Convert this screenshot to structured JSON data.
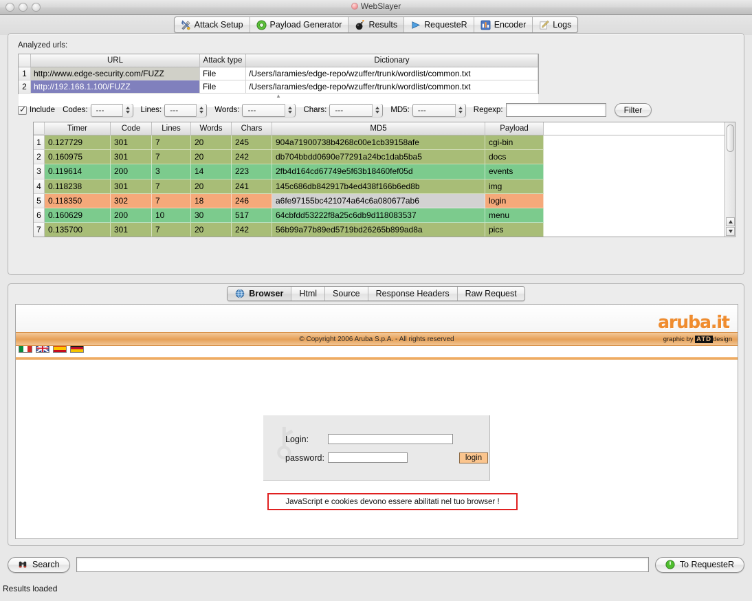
{
  "window": {
    "title": "WebSlayer"
  },
  "main_tabs": [
    {
      "label": "Attack Setup",
      "icon": "wrench-screwdriver-icon",
      "selected": false
    },
    {
      "label": "Payload Generator",
      "icon": "green-gear-icon",
      "selected": false
    },
    {
      "label": "Results",
      "icon": "bomb-icon",
      "selected": true
    },
    {
      "label": "RequesteR",
      "icon": "blue-play-icon",
      "selected": false
    },
    {
      "label": "Encoder",
      "icon": "blue-grid-icon",
      "selected": false
    },
    {
      "label": "Logs",
      "icon": "pencil-note-icon",
      "selected": false
    }
  ],
  "urls_section": {
    "label": "Analyzed urls:",
    "columns": [
      "",
      "URL",
      "Attack type",
      "Dictionary"
    ],
    "rows": [
      {
        "num": "1",
        "url": "http://www.edge-security.com/FUZZ",
        "attack_type": "File",
        "dictionary": "/Users/laramies/edge-repo/wzuffer/trunk/wordlist/common.txt",
        "state": "highlight"
      },
      {
        "num": "2",
        "url": "http://192.168.1.100/FUZZ",
        "attack_type": "File",
        "dictionary": "/Users/laramies/edge-repo/wzuffer/trunk/wordlist/common.txt",
        "state": "selected"
      }
    ]
  },
  "filter_bar": {
    "include_label": "Include",
    "include_checked": true,
    "codes_label": "Codes:",
    "codes_value": "---",
    "lines_label": "Lines:",
    "lines_value": "---",
    "words_label": "Words:",
    "words_value": "---",
    "chars_label": "Chars:",
    "chars_value": "---",
    "md5_label": "MD5:",
    "md5_value": "---",
    "regexp_label": "Regexp:",
    "regexp_value": "",
    "regexp_placeholder": "",
    "filter_button": "Filter"
  },
  "results_table": {
    "columns": [
      "",
      "Timer",
      "Code",
      "Lines",
      "Words",
      "Chars",
      "MD5",
      "Payload"
    ],
    "colors": {
      "green_200": "#7ccb8d",
      "olive_301": "#a8bd77",
      "orange_302": "#f5a97a",
      "md5_grey": "#d2d2d2"
    },
    "rows": [
      {
        "num": "1",
        "timer": "0.127729",
        "code": "301",
        "lines": "7",
        "words": "20",
        "chars": "245",
        "md5": "904a71900738b4268c00e1cb39158afe",
        "payload": "cgi-bin",
        "color": "olive"
      },
      {
        "num": "2",
        "timer": "0.160975",
        "code": "301",
        "lines": "7",
        "words": "20",
        "chars": "242",
        "md5": "db704bbdd0690e77291a24bc1dab5ba5",
        "payload": "docs",
        "color": "olive"
      },
      {
        "num": "3",
        "timer": "0.119614",
        "code": "200",
        "lines": "3",
        "words": "14",
        "chars": "223",
        "md5": "2fb4d164cd67749e5f63b18460fef05d",
        "payload": "events",
        "color": "green"
      },
      {
        "num": "4",
        "timer": "0.118238",
        "code": "301",
        "lines": "7",
        "words": "20",
        "chars": "241",
        "md5": "145c686db842917b4ed438f166b6ed8b",
        "payload": "img",
        "color": "olive"
      },
      {
        "num": "5",
        "timer": "0.118350",
        "code": "302",
        "lines": "7",
        "words": "18",
        "chars": "246",
        "md5": "a6fe97155bc421074a64c6a080677ab6",
        "payload": "login",
        "color": "orange"
      },
      {
        "num": "6",
        "timer": "0.160629",
        "code": "200",
        "lines": "10",
        "words": "30",
        "chars": "517",
        "md5": "64cbfdd53222f8a25c6db9d118083537",
        "payload": "menu",
        "color": "green"
      },
      {
        "num": "7",
        "timer": "0.135700",
        "code": "301",
        "lines": "7",
        "words": "20",
        "chars": "242",
        "md5": "56b99a77b89ed5719bd26265b899ad8a",
        "payload": "pics",
        "color": "olive"
      }
    ]
  },
  "browser_tabs": [
    {
      "label": "Browser",
      "icon": "globe-icon",
      "selected": true
    },
    {
      "label": "Html",
      "selected": false
    },
    {
      "label": "Source",
      "selected": false
    },
    {
      "label": "Response Headers",
      "selected": false
    },
    {
      "label": "Raw Request",
      "selected": false
    }
  ],
  "web_page": {
    "logo_text": "aruba.it",
    "languages": [
      "italy-flag",
      "uk-flag",
      "spain-flag",
      "germany-flag"
    ],
    "login_label": "Login:",
    "login_value": "",
    "password_label": "password:",
    "password_value": "",
    "login_button": "login",
    "js_warning": "JavaScript e cookies devono essere abilitati nel tuo browser !",
    "copyright": "© Copyright 2006 Aruba S.p.A. - All rights reserved",
    "graphic_by_prefix": "graphic by ",
    "graphic_by_mark": "ATD",
    "graphic_by_suffix": "design"
  },
  "bottom_bar": {
    "search_button": "Search",
    "search_value": "",
    "search_placeholder": "",
    "to_requester_button": "To RequesteR"
  },
  "status_bar": {
    "text": "Results loaded"
  }
}
